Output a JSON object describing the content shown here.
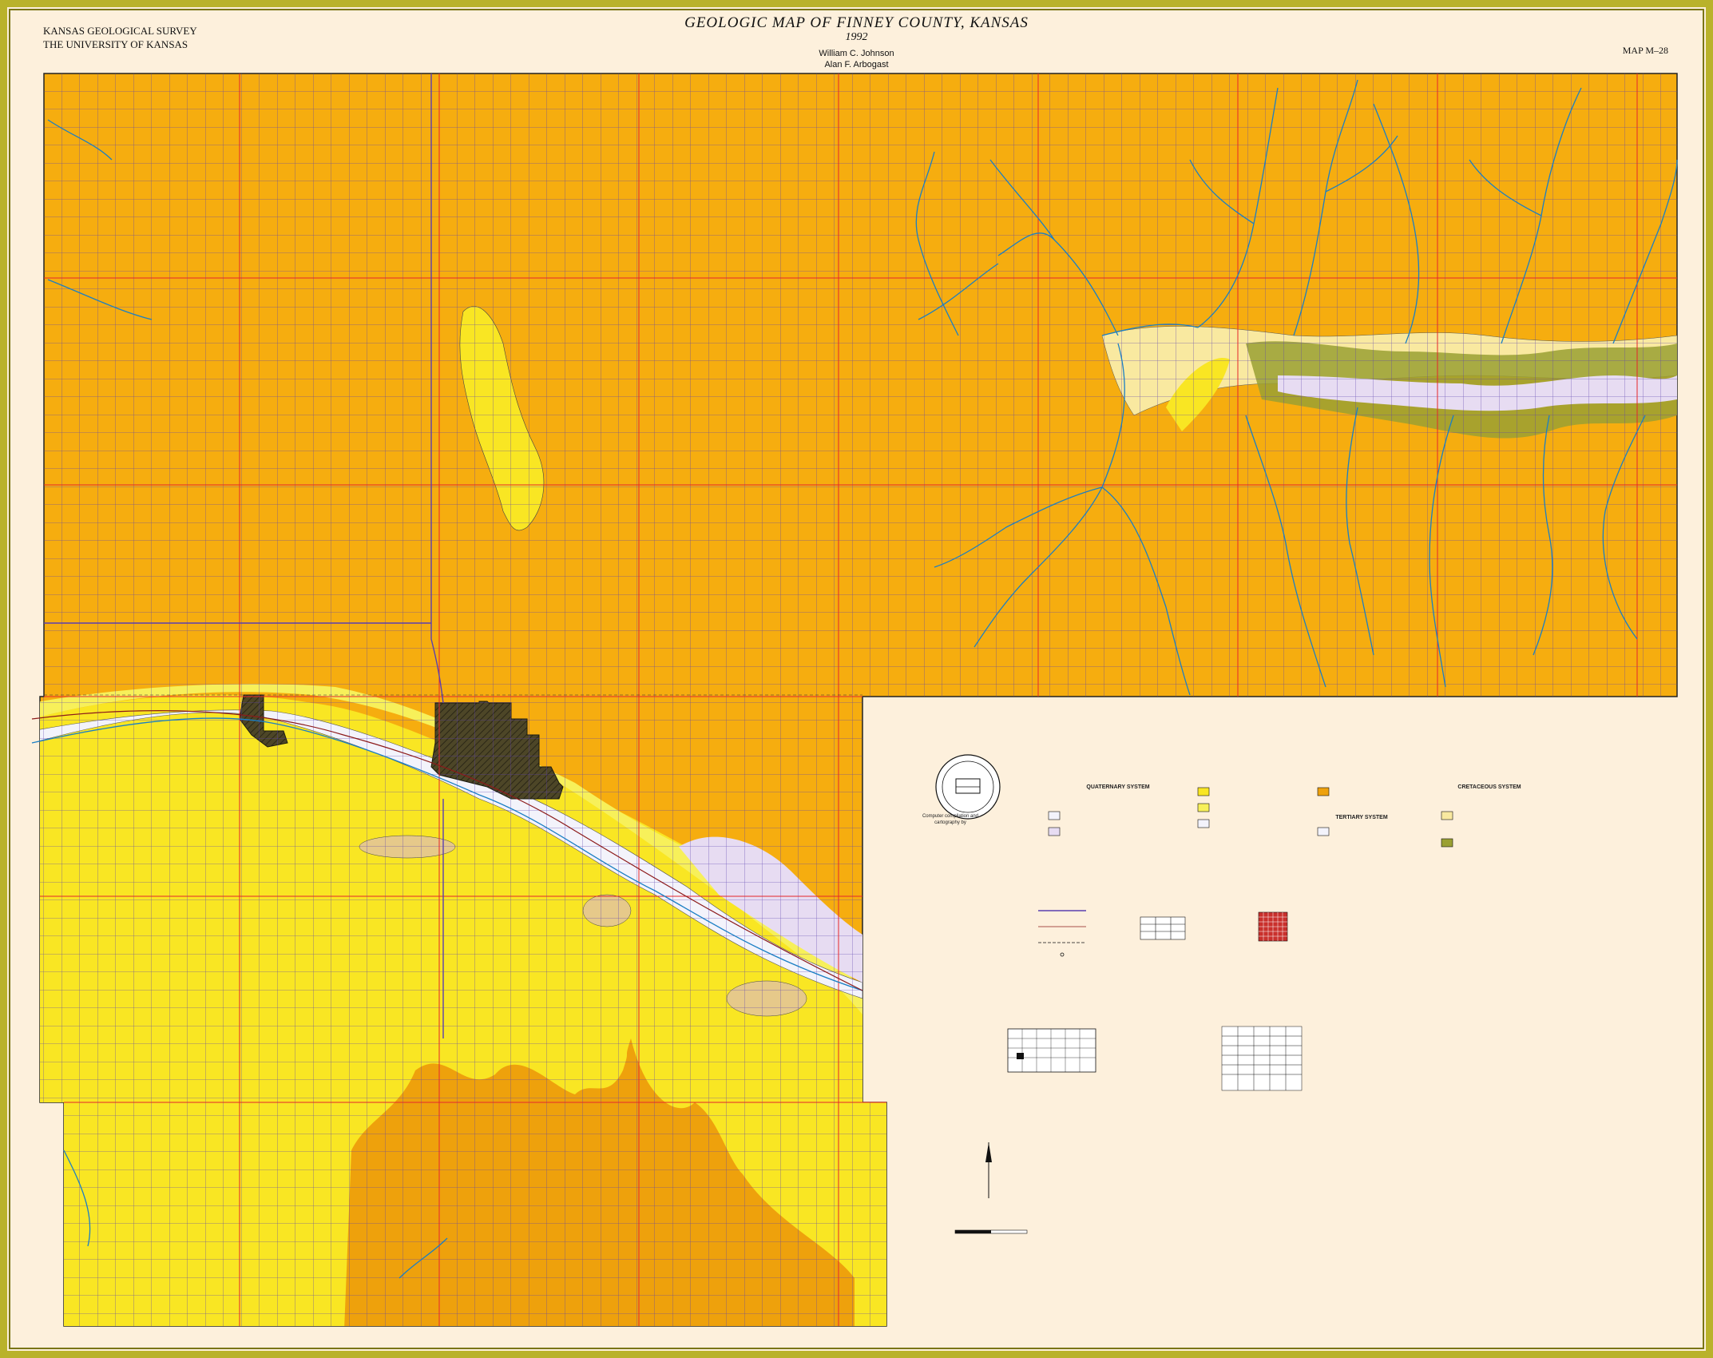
{
  "header": {
    "org_line1": "KANSAS GEOLOGICAL SURVEY",
    "org_line2": "THE UNIVERSITY OF KANSAS",
    "title": "GEOLOGIC MAP OF FINNEY COUNTY, KANSAS",
    "year": "1992",
    "author1": "William C. Johnson",
    "author2": "Alan F. Arbogast",
    "map_number": "MAP M–28"
  },
  "legend": {
    "quaternary_heading": "QUATERNARY SYSTEM",
    "tertiary_heading": "TERTIARY SYSTEM",
    "cretaceous_heading": "CRETACEOUS SYSTEM",
    "compilation_note": "Computer compilation and cartography by"
  },
  "colors": {
    "upland_orange": "#f6ad0f",
    "upland_dark_orange": "#eea10c",
    "yellow_unit": "#f9e623",
    "pale_yellow_unit": "#f7f05a",
    "alluvium_white": "#f3f3fb",
    "olive_unit": "#9aa032",
    "lavender_unit": "#e7dcf2",
    "tan_unit": "#e6c98a",
    "dark_urban": "#4d4627",
    "section_lines": "#5a3fb0",
    "township_lines": "#e5262b",
    "stream_lines": "#1b7fc4",
    "frame": "#b9b22b"
  },
  "icons": [
    "seal-icon",
    "north-arrow-icon",
    "index-map-icon",
    "scale-bar-icon"
  ]
}
